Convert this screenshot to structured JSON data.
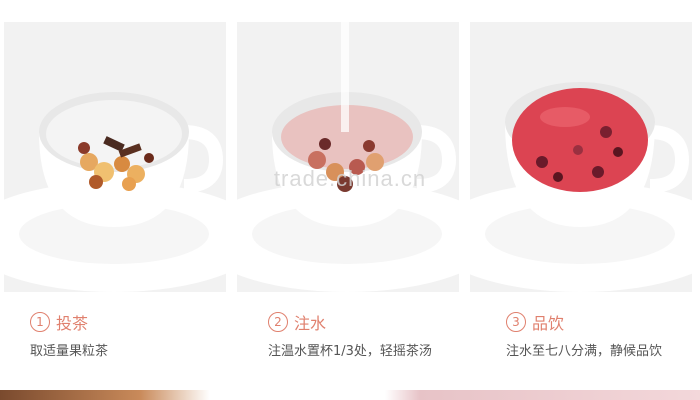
{
  "steps": [
    {
      "num": "1",
      "title": "投茶",
      "desc": "取适量果粒茶",
      "tea_color": "#c9844e"
    },
    {
      "num": "2",
      "title": "注水",
      "desc": "注温水置杯1/3处，轻摇茶汤",
      "tea_color": "#c8686a"
    },
    {
      "num": "3",
      "title": "品饮",
      "desc": "注水至七八分满，静候品饮",
      "tea_color": "#d9404e"
    }
  ],
  "watermark": "trade.china.cn",
  "colors": {
    "accent": "#e0806e",
    "text": "#555555",
    "panel_bg": "#f2f2f2"
  }
}
